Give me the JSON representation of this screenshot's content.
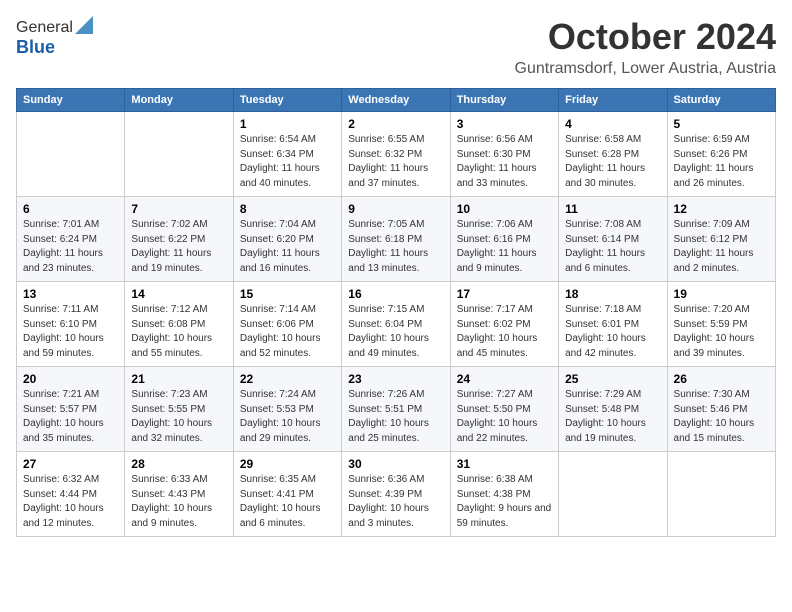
{
  "logo": {
    "general": "General",
    "blue": "Blue"
  },
  "title": "October 2024",
  "subtitle": "Guntramsdorf, Lower Austria, Austria",
  "headers": [
    "Sunday",
    "Monday",
    "Tuesday",
    "Wednesday",
    "Thursday",
    "Friday",
    "Saturday"
  ],
  "weeks": [
    [
      {
        "day": "",
        "info": ""
      },
      {
        "day": "",
        "info": ""
      },
      {
        "day": "1",
        "info": "Sunrise: 6:54 AM\nSunset: 6:34 PM\nDaylight: 11 hours and 40 minutes."
      },
      {
        "day": "2",
        "info": "Sunrise: 6:55 AM\nSunset: 6:32 PM\nDaylight: 11 hours and 37 minutes."
      },
      {
        "day": "3",
        "info": "Sunrise: 6:56 AM\nSunset: 6:30 PM\nDaylight: 11 hours and 33 minutes."
      },
      {
        "day": "4",
        "info": "Sunrise: 6:58 AM\nSunset: 6:28 PM\nDaylight: 11 hours and 30 minutes."
      },
      {
        "day": "5",
        "info": "Sunrise: 6:59 AM\nSunset: 6:26 PM\nDaylight: 11 hours and 26 minutes."
      }
    ],
    [
      {
        "day": "6",
        "info": "Sunrise: 7:01 AM\nSunset: 6:24 PM\nDaylight: 11 hours and 23 minutes."
      },
      {
        "day": "7",
        "info": "Sunrise: 7:02 AM\nSunset: 6:22 PM\nDaylight: 11 hours and 19 minutes."
      },
      {
        "day": "8",
        "info": "Sunrise: 7:04 AM\nSunset: 6:20 PM\nDaylight: 11 hours and 16 minutes."
      },
      {
        "day": "9",
        "info": "Sunrise: 7:05 AM\nSunset: 6:18 PM\nDaylight: 11 hours and 13 minutes."
      },
      {
        "day": "10",
        "info": "Sunrise: 7:06 AM\nSunset: 6:16 PM\nDaylight: 11 hours and 9 minutes."
      },
      {
        "day": "11",
        "info": "Sunrise: 7:08 AM\nSunset: 6:14 PM\nDaylight: 11 hours and 6 minutes."
      },
      {
        "day": "12",
        "info": "Sunrise: 7:09 AM\nSunset: 6:12 PM\nDaylight: 11 hours and 2 minutes."
      }
    ],
    [
      {
        "day": "13",
        "info": "Sunrise: 7:11 AM\nSunset: 6:10 PM\nDaylight: 10 hours and 59 minutes."
      },
      {
        "day": "14",
        "info": "Sunrise: 7:12 AM\nSunset: 6:08 PM\nDaylight: 10 hours and 55 minutes."
      },
      {
        "day": "15",
        "info": "Sunrise: 7:14 AM\nSunset: 6:06 PM\nDaylight: 10 hours and 52 minutes."
      },
      {
        "day": "16",
        "info": "Sunrise: 7:15 AM\nSunset: 6:04 PM\nDaylight: 10 hours and 49 minutes."
      },
      {
        "day": "17",
        "info": "Sunrise: 7:17 AM\nSunset: 6:02 PM\nDaylight: 10 hours and 45 minutes."
      },
      {
        "day": "18",
        "info": "Sunrise: 7:18 AM\nSunset: 6:01 PM\nDaylight: 10 hours and 42 minutes."
      },
      {
        "day": "19",
        "info": "Sunrise: 7:20 AM\nSunset: 5:59 PM\nDaylight: 10 hours and 39 minutes."
      }
    ],
    [
      {
        "day": "20",
        "info": "Sunrise: 7:21 AM\nSunset: 5:57 PM\nDaylight: 10 hours and 35 minutes."
      },
      {
        "day": "21",
        "info": "Sunrise: 7:23 AM\nSunset: 5:55 PM\nDaylight: 10 hours and 32 minutes."
      },
      {
        "day": "22",
        "info": "Sunrise: 7:24 AM\nSunset: 5:53 PM\nDaylight: 10 hours and 29 minutes."
      },
      {
        "day": "23",
        "info": "Sunrise: 7:26 AM\nSunset: 5:51 PM\nDaylight: 10 hours and 25 minutes."
      },
      {
        "day": "24",
        "info": "Sunrise: 7:27 AM\nSunset: 5:50 PM\nDaylight: 10 hours and 22 minutes."
      },
      {
        "day": "25",
        "info": "Sunrise: 7:29 AM\nSunset: 5:48 PM\nDaylight: 10 hours and 19 minutes."
      },
      {
        "day": "26",
        "info": "Sunrise: 7:30 AM\nSunset: 5:46 PM\nDaylight: 10 hours and 15 minutes."
      }
    ],
    [
      {
        "day": "27",
        "info": "Sunrise: 6:32 AM\nSunset: 4:44 PM\nDaylight: 10 hours and 12 minutes."
      },
      {
        "day": "28",
        "info": "Sunrise: 6:33 AM\nSunset: 4:43 PM\nDaylight: 10 hours and 9 minutes."
      },
      {
        "day": "29",
        "info": "Sunrise: 6:35 AM\nSunset: 4:41 PM\nDaylight: 10 hours and 6 minutes."
      },
      {
        "day": "30",
        "info": "Sunrise: 6:36 AM\nSunset: 4:39 PM\nDaylight: 10 hours and 3 minutes."
      },
      {
        "day": "31",
        "info": "Sunrise: 6:38 AM\nSunset: 4:38 PM\nDaylight: 9 hours and 59 minutes."
      },
      {
        "day": "",
        "info": ""
      },
      {
        "day": "",
        "info": ""
      }
    ]
  ]
}
